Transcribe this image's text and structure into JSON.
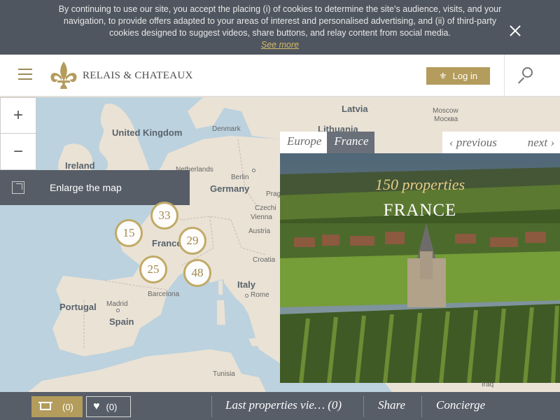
{
  "cookie": {
    "text": "By continuing to use our site, you accept the placing (i) of cookies to determine the site's audience, visits, and your navigation, to provide offers adapted to your areas of interest and personalised advertising, and (ii) of third-party cookies designed to suggest videos, share buttons, and relay content from social media.",
    "see_more": "See more"
  },
  "header": {
    "logo_text": "RELAIS & CHATEAUX",
    "login_label": "Log in",
    "accent": "#b39c5c"
  },
  "map": {
    "zoom_in": "+",
    "zoom_out": "−",
    "enlarge_label": "Enlarge the map",
    "places": {
      "latvia": "Latvia",
      "lithuania": "Lithuania",
      "moscow": "Moscow",
      "moscow_ru": "Москва",
      "uk": "United Kingdom",
      "denmark": "Denmark",
      "ireland": "Ireland",
      "netherlands": "Netherlands",
      "berlin": "Berlin",
      "germany": "Germany",
      "prague": "Prag",
      "czechia": "Czechi",
      "vienna": "Vienna",
      "austria": "Austria",
      "france": "France",
      "croatia": "Croatia",
      "italy": "Italy",
      "rome": "Rome",
      "portugal": "Portugal",
      "madrid": "Madrid",
      "spain": "Spain",
      "barcelona": "Barcelona",
      "tunisia": "Tunisia",
      "iraq": "Iraq"
    },
    "clusters": {
      "c33": "33",
      "c15": "15",
      "c29": "29",
      "c25": "25",
      "c48": "48"
    }
  },
  "card": {
    "tab_europe": "Europe",
    "tab_france": "France",
    "previous": "previous",
    "next": "next",
    "count": "150 properties",
    "name": "FRANCE"
  },
  "bottom": {
    "basket_count": "(0)",
    "fav_count": "(0)",
    "last_viewed": "Last properties vie…  (0)",
    "share": "Share",
    "concierge": "Concierge"
  }
}
